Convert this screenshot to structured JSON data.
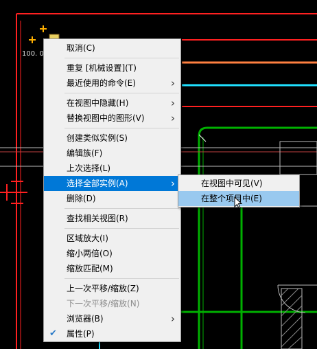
{
  "drawing": {
    "dimension_label": "100. 0"
  },
  "context_menu": {
    "groups": [
      [
        {
          "label": "取消(C)",
          "arrow": false,
          "disabled": false
        }
      ],
      [
        {
          "label": "重复 [机械设置](T)",
          "arrow": false,
          "disabled": false
        },
        {
          "label": "最近使用的命令(E)",
          "arrow": true,
          "disabled": false
        }
      ],
      [
        {
          "label": "在视图中隐藏(H)",
          "arrow": true,
          "disabled": false
        },
        {
          "label": "替换视图中的图形(V)",
          "arrow": true,
          "disabled": false
        }
      ],
      [
        {
          "label": "创建类似实例(S)",
          "arrow": false,
          "disabled": false
        },
        {
          "label": "编辑族(F)",
          "arrow": false,
          "disabled": false
        },
        {
          "label": "上次选择(L)",
          "arrow": false,
          "disabled": false
        },
        {
          "label": "选择全部实例(A)",
          "arrow": true,
          "disabled": false,
          "hover": true
        },
        {
          "label": "删除(D)",
          "arrow": false,
          "disabled": false
        }
      ],
      [
        {
          "label": "查找相关视图(R)",
          "arrow": false,
          "disabled": false
        }
      ],
      [
        {
          "label": "区域放大(I)",
          "arrow": false,
          "disabled": false
        },
        {
          "label": "缩小两倍(O)",
          "arrow": false,
          "disabled": false
        },
        {
          "label": "缩放匹配(M)",
          "arrow": false,
          "disabled": false
        }
      ],
      [
        {
          "label": "上一次平移/缩放(Z)",
          "arrow": false,
          "disabled": false
        },
        {
          "label": "下一次平移/缩放(N)",
          "arrow": false,
          "disabled": true
        },
        {
          "label": "浏览器(B)",
          "arrow": true,
          "disabled": false
        },
        {
          "label": "属性(P)",
          "arrow": false,
          "disabled": false,
          "checked": true
        }
      ]
    ]
  },
  "submenu": {
    "items": [
      {
        "label": "在视图中可见(V)"
      },
      {
        "label": "在整个项目中(E)",
        "hover": true
      }
    ]
  },
  "icons": {
    "submenu_arrow": "chevron-right-icon",
    "checkmark": "checkmark-icon",
    "cursor": "arrow-cursor-icon"
  },
  "colors": {
    "background": "#000000",
    "line_red": "#ff2020",
    "line_orange": "#ff8040",
    "line_cyan": "#20e0ff",
    "line_green": "#00a000",
    "line_white": "#ffffff",
    "menu_bg": "#f0f0f0",
    "menu_hover": "#0078d7",
    "submenu_hover": "#99c9ef"
  }
}
